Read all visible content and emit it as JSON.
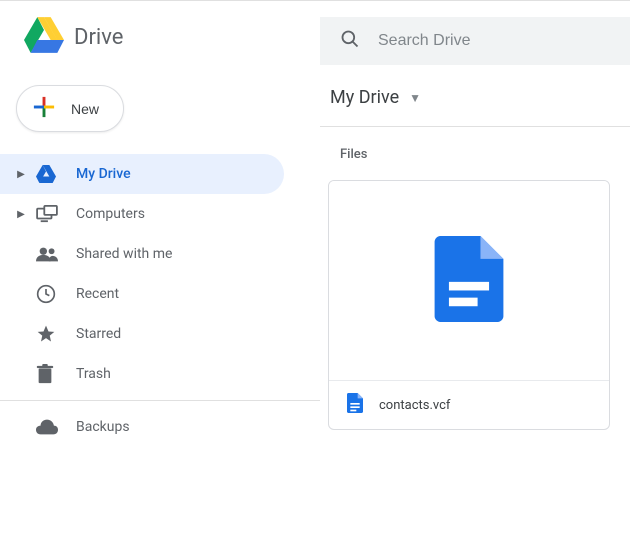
{
  "header": {
    "app_title": "Drive"
  },
  "sidebar": {
    "new_label": "New",
    "items": [
      {
        "label": "My Drive",
        "icon": "drive-logo-icon",
        "has_arrow": true,
        "active": true
      },
      {
        "label": "Computers",
        "icon": "computers-icon",
        "has_arrow": true,
        "active": false
      },
      {
        "label": "Shared with me",
        "icon": "shared-icon",
        "has_arrow": false,
        "active": false
      },
      {
        "label": "Recent",
        "icon": "recent-icon",
        "has_arrow": false,
        "active": false
      },
      {
        "label": "Starred",
        "icon": "star-icon",
        "has_arrow": false,
        "active": false
      },
      {
        "label": "Trash",
        "icon": "trash-icon",
        "has_arrow": false,
        "active": false
      }
    ],
    "backups_label": "Backups"
  },
  "search": {
    "placeholder": "Search Drive",
    "value": ""
  },
  "breadcrumb": {
    "current": "My Drive"
  },
  "main": {
    "section_label": "Files",
    "files": [
      {
        "name": "contacts.vcf"
      }
    ]
  },
  "colors": {
    "active_bg": "#e8f0fe",
    "active_fg": "#1967d2",
    "muted": "#5f6368",
    "file_blue": "#1a73e8"
  }
}
